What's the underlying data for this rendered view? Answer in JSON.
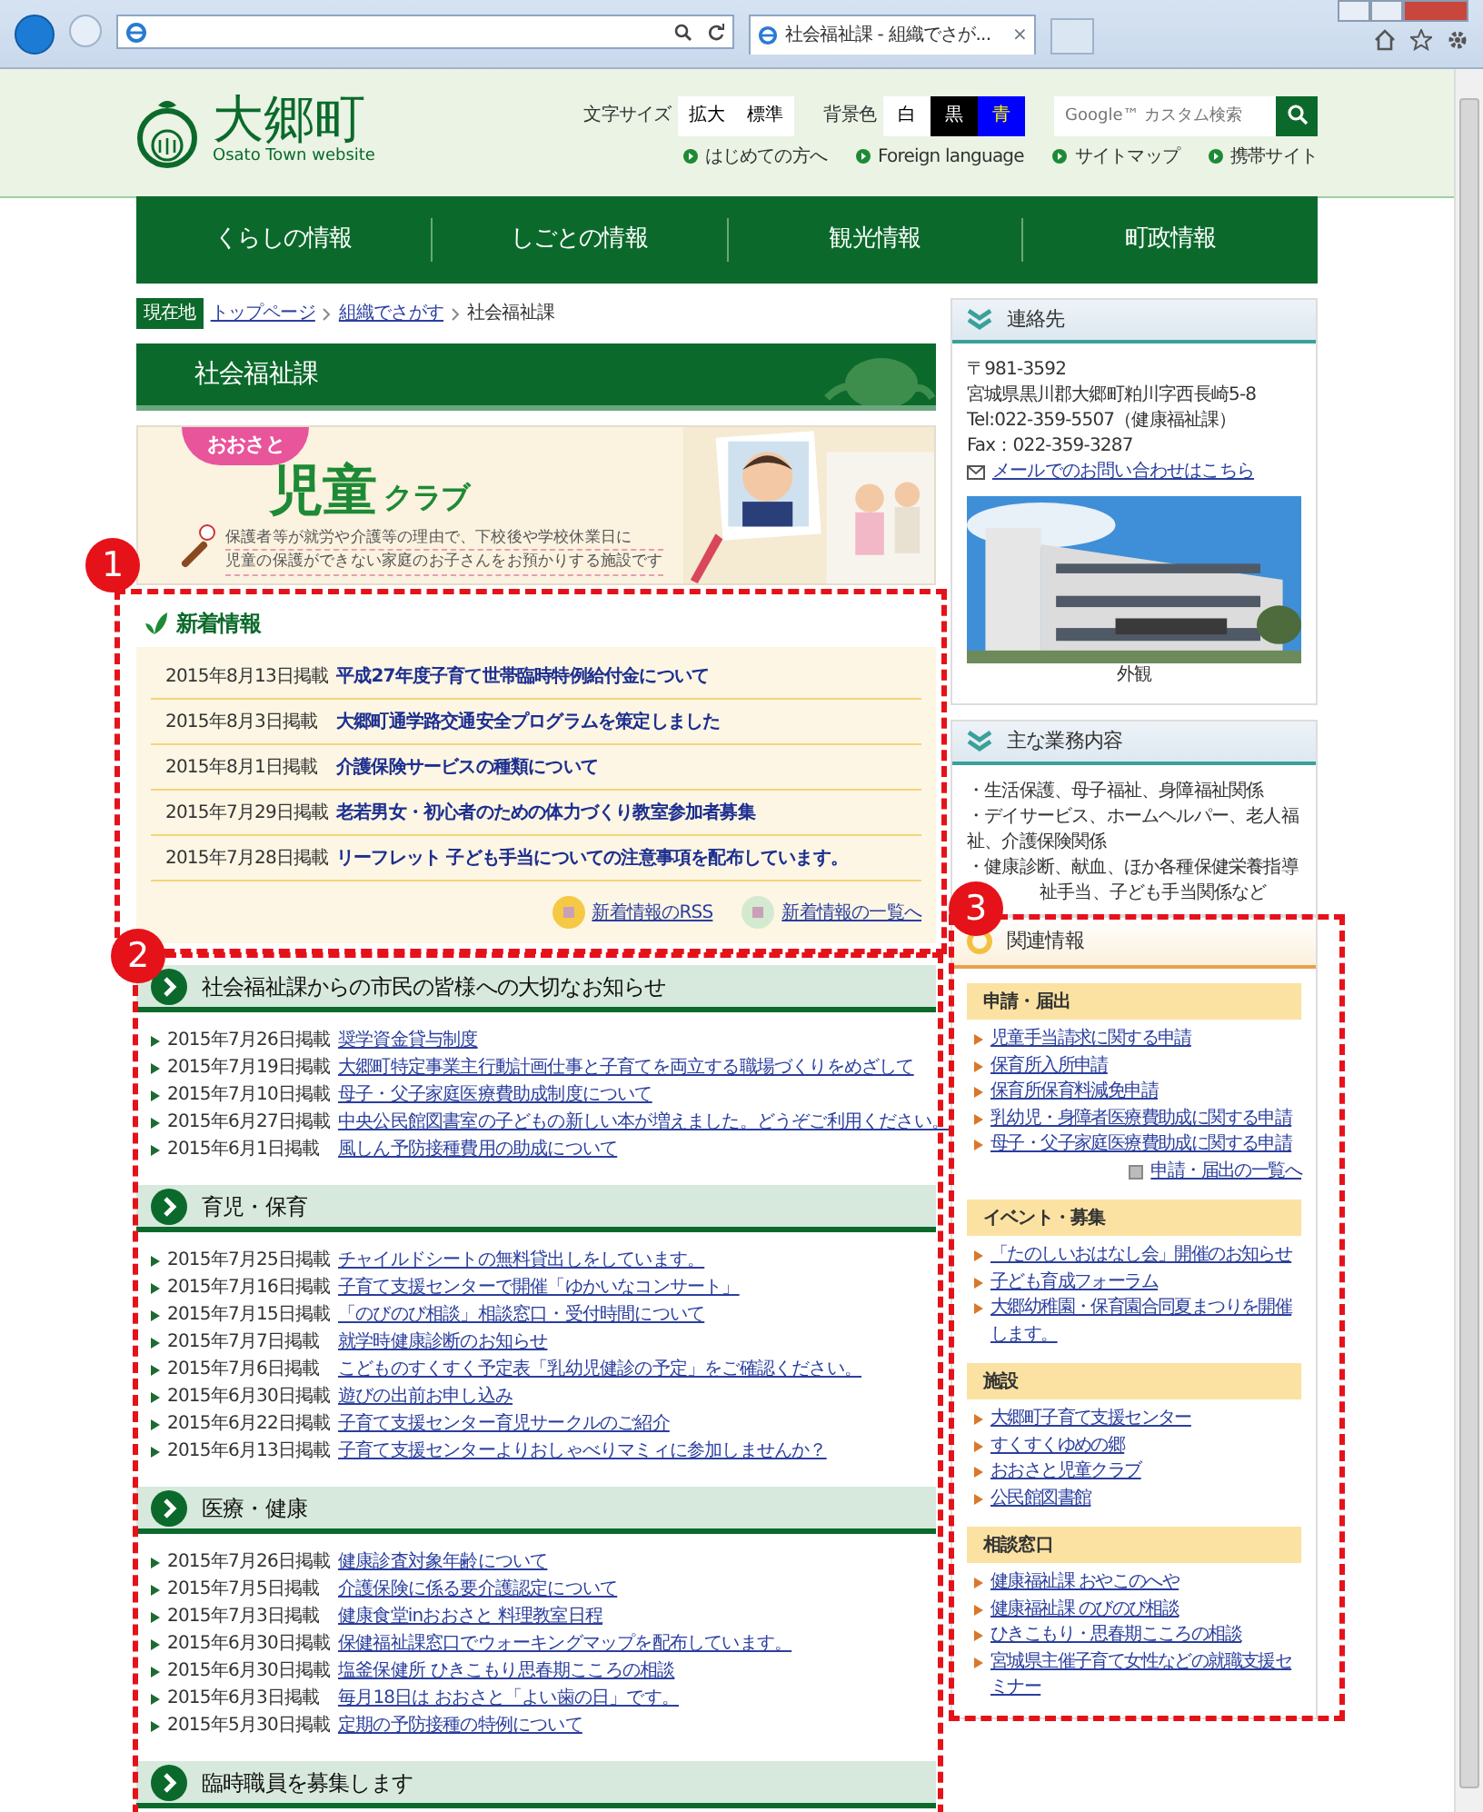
{
  "browser": {
    "tab_title": "社会福祉課 - 組織でさが...",
    "tab_close": "×"
  },
  "header": {
    "logo_title": "大郷町",
    "logo_sub": "Osato Town website",
    "font_size_label": "文字サイズ",
    "font_buttons": [
      "拡大",
      "標準"
    ],
    "bg_label": "背景色",
    "bg_buttons": [
      {
        "label": "白",
        "color": "#ffffff"
      },
      {
        "label": "黒",
        "color": "#000000"
      },
      {
        "label": "青",
        "color": "#0000ff"
      }
    ],
    "search": {
      "placeholder": "Google™ カスタム検索"
    },
    "util_links": [
      "はじめての方へ",
      "Foreign language",
      "サイトマップ",
      "携帯サイト"
    ]
  },
  "nav": [
    "くらしの情報",
    "しごとの情報",
    "観光情報",
    "町政情報"
  ],
  "breadcrumb": {
    "label": "現在地",
    "items": [
      {
        "text": "トップページ",
        "kind": "link"
      },
      {
        "text": "組織でさがす",
        "kind": "link"
      },
      {
        "text": "社会福祉課",
        "kind": "current"
      }
    ]
  },
  "page_title": "社会福祉課",
  "banner": {
    "badge": "おおさと",
    "title_main": "児童",
    "title_sub": "クラブ",
    "lines": [
      "保護者等が就労や介護等の理由で、下校後や学校休業日に",
      "児童の保護ができない家庭のお子さんをお預かりする施設です"
    ]
  },
  "news": {
    "callout": "1",
    "heading": "新着情報",
    "items": [
      {
        "date": "2015年8月13日掲載",
        "title": "平成27年度子育て世帯臨時特例給付金について"
      },
      {
        "date": "2015年8月3日掲載",
        "title": "大郷町通学路交通安全プログラムを策定しました"
      },
      {
        "date": "2015年8月1日掲載",
        "title": "介護保険サービスの種類について"
      },
      {
        "date": "2015年7月29日掲載",
        "title": "老若男女・初心者のための体力づくり教室参加者募集"
      },
      {
        "date": "2015年7月28日掲載",
        "title": "リーフレット 子ども手当についての注意事項を配布しています。"
      }
    ],
    "links": [
      {
        "text": "新着情報のRSS",
        "kind": "rss"
      },
      {
        "text": "新着情報の一覧へ",
        "kind": "list"
      }
    ]
  },
  "sections_callout": "2",
  "sections": [
    {
      "heading": "社会福祉課からの市民の皆様への大切なお知らせ",
      "items": [
        {
          "date": "2015年7月26日掲載",
          "title": "奨学資金貸与制度"
        },
        {
          "date": "2015年7月19日掲載",
          "title": "大郷町特定事業主行動計画仕事と子育てを両立する職場づくりをめざして"
        },
        {
          "date": "2015年7月10日掲載",
          "title": "母子・父子家庭医療費助成制度について"
        },
        {
          "date": "2015年6月27日掲載",
          "title": "中央公民館図書室の子どもの新しい本が増えました。どうぞご利用ください。"
        },
        {
          "date": "2015年6月1日掲載",
          "title": "風しん予防接種費用の助成について"
        }
      ]
    },
    {
      "heading": "育児・保育",
      "items": [
        {
          "date": "2015年7月25日掲載",
          "title": "チャイルドシートの無料貸出しをしています。"
        },
        {
          "date": "2015年7月16日掲載",
          "title": "子育て支援センターで開催「ゆかいなコンサート」"
        },
        {
          "date": "2015年7月15日掲載",
          "title": "「のびのび相談」相談窓口・受付時間について"
        },
        {
          "date": "2015年7月7日掲載",
          "title": "就学時健康診断のお知らせ"
        },
        {
          "date": "2015年7月6日掲載",
          "title": "こどものすくすく予定表「乳幼児健診の予定」をご確認ください。"
        },
        {
          "date": "2015年6月30日掲載",
          "title": "遊びの出前お申し込み"
        },
        {
          "date": "2015年6月22日掲載",
          "title": "子育て支援センター育児サークルのご紹介"
        },
        {
          "date": "2015年6月13日掲載",
          "title": "子育て支援センターよりおしゃべりマミィに参加しませんか？"
        }
      ]
    },
    {
      "heading": "医療・健康",
      "items": [
        {
          "date": "2015年7月26日掲載",
          "title": "健康診査対象年齢について"
        },
        {
          "date": "2015年7月5日掲載",
          "title": "介護保険に係る要介護認定について"
        },
        {
          "date": "2015年7月3日掲載",
          "title": "健康食堂inおおさと 料理教室日程"
        },
        {
          "date": "2015年6月30日掲載",
          "title": "保健福祉課窓口でウォーキングマップを配布しています。"
        },
        {
          "date": "2015年6月30日掲載",
          "title": "塩釜保健所 ひきこもり思春期こころの相談"
        },
        {
          "date": "2015年6月3日掲載",
          "title": "毎月18日は おおさと「よい歯の日」です。"
        },
        {
          "date": "2015年5月30日掲載",
          "title": "定期の予防接種の特例について"
        }
      ]
    },
    {
      "heading": "臨時職員を募集します"
    }
  ],
  "sidebar": {
    "contact": {
      "heading": "連絡先",
      "lines": [
        "〒981-3592",
        "宮城県黒川郡大郷町粕川字西長崎5-8",
        "Tel:022-359-5507（健康福祉課）",
        "Fax：022-359-3287"
      ],
      "mail_link": "メールでのお問い合わせはこちら",
      "caption": "外観"
    },
    "duties": {
      "heading": "主な業務内容",
      "lines": [
        "・生活保護、母子福祉、身障福祉関係",
        "・デイサービス、ホームヘルパー、老人福祉、介護保険関係",
        "・健康診断、献血、ほか各種保健栄養指導",
        "祉手当、子ども手当関係など"
      ]
    },
    "related": {
      "callout": "3",
      "heading": "関連情報",
      "groups": [
        {
          "heading": "申請・届出",
          "links": [
            "児童手当請求に関する申請",
            "保育所入所申請",
            "保育所保育料減免申請",
            "乳幼児・身障者医療費助成に関する申請",
            "母子・父子家庭医療費助成に関する申請"
          ],
          "more": "申請・届出の一覧へ"
        },
        {
          "heading": "イベント・募集",
          "links": [
            "「たのしいおはなし会」開催のお知らせ",
            "子ども育成フォーラム",
            "大郷幼稚園・保育園合同夏まつりを開催します。"
          ]
        },
        {
          "heading": "施設",
          "links": [
            "大郷町子育て支援センター",
            "すくすくゆめの郷",
            "おおさと児童クラブ",
            "公民館図書館"
          ]
        },
        {
          "heading": "相談窓口",
          "links": [
            "健康福祉課 おやこのへや",
            "健康福祉課 のびのび相談",
            "ひきこもり・思春期こころの相談",
            "宮城県主催子育て女性などの就職支援セミナー"
          ]
        }
      ]
    }
  }
}
